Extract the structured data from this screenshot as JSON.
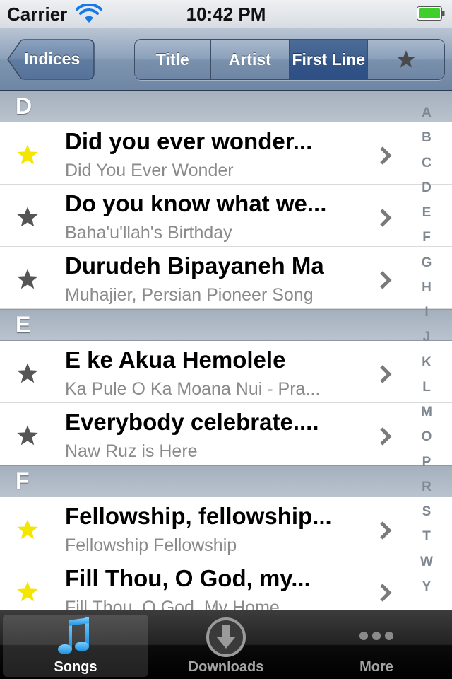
{
  "status_bar": {
    "carrier": "Carrier",
    "time": "10:42 PM"
  },
  "nav": {
    "back_label": "Indices",
    "segments": [
      {
        "label": "Title",
        "selected": false
      },
      {
        "label": "Artist",
        "selected": false
      },
      {
        "label": "First Line",
        "selected": true
      },
      {
        "icon": "star-icon",
        "selected": false
      }
    ]
  },
  "sections": [
    {
      "letter": "D",
      "rows": [
        {
          "title": "Did you ever wonder...",
          "subtitle": "Did You Ever Wonder",
          "favorite": true
        },
        {
          "title": "Do you know what we...",
          "subtitle": "Baha'u'llah's Birthday",
          "favorite": false
        },
        {
          "title": "Durudeh Bipayaneh Ma",
          "subtitle": "Muhajier, Persian Pioneer Song",
          "favorite": false
        }
      ]
    },
    {
      "letter": "E",
      "rows": [
        {
          "title": "E ke Akua Hemolele",
          "subtitle": "Ka Pule O Ka Moana Nui  - Pra...",
          "favorite": false
        },
        {
          "title": "Everybody celebrate....",
          "subtitle": "Naw Ruz is Here",
          "favorite": false
        }
      ]
    },
    {
      "letter": "F",
      "rows": [
        {
          "title": "Fellowship, fellowship...",
          "subtitle": "Fellowship Fellowship",
          "favorite": true
        },
        {
          "title": "Fill Thou, O God, my...",
          "subtitle": "Fill Thou, O God, My Home",
          "favorite": true
        }
      ]
    }
  ],
  "index_letters": [
    "A",
    "B",
    "C",
    "D",
    "E",
    "F",
    "G",
    "H",
    "I",
    "J",
    "K",
    "L",
    "M",
    "O",
    "P",
    "R",
    "S",
    "T",
    "W",
    "Y"
  ],
  "tabs": [
    {
      "label": "Songs",
      "icon": "music-note-icon",
      "selected": true
    },
    {
      "label": "Downloads",
      "icon": "download-icon",
      "selected": false
    },
    {
      "label": "More",
      "icon": "more-dots-icon",
      "selected": false
    }
  ],
  "colors": {
    "favorite_star": "#f5e600",
    "normal_star": "#555555",
    "nav_blue": "#6e86a5",
    "selected_segment": "#34558a",
    "songs_icon": "#33a6f0"
  }
}
